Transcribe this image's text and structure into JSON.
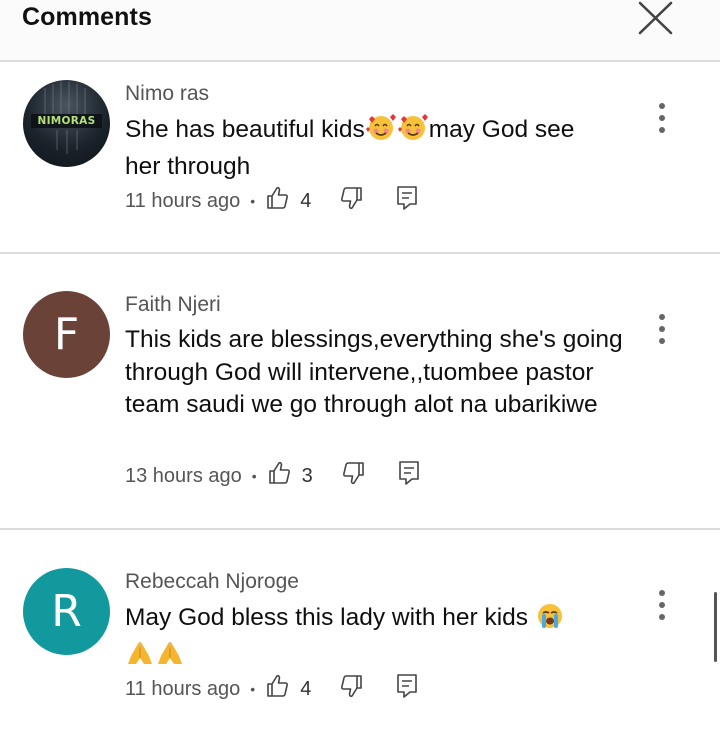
{
  "header": {
    "title": "Comments",
    "close_icon": "close-icon"
  },
  "colors": {
    "avatar_f": "#6b4238",
    "avatar_r": "#11999e",
    "divider": "#dcdcdc",
    "meta_text": "#555555"
  },
  "comments": [
    {
      "avatar_type": "photo",
      "avatar_text": "NIMORAS",
      "author": "Nimo ras",
      "text_before_emoji": "She has beautiful kids",
      "emoji": "smiling-face-with-hearts x2",
      "text_after_emoji": "may God see",
      "text_line2": "her through",
      "time": "11 hours ago",
      "likes": "4"
    },
    {
      "avatar_type": "letter",
      "avatar_letter": "F",
      "author": "Faith Njeri",
      "text": "This kids are blessings,everything she's going through God will intervene,,tuombee pastor team saudi we go through alot na ubarikiwe",
      "time": "13 hours ago",
      "likes": "3"
    },
    {
      "avatar_type": "letter",
      "avatar_letter": "R",
      "author": "Rebeccah Njoroge",
      "text": "May God bless this lady with her kids",
      "emoji": "loudly-crying-face, folded-hands x2",
      "time": "11 hours ago",
      "likes": "4"
    }
  ]
}
